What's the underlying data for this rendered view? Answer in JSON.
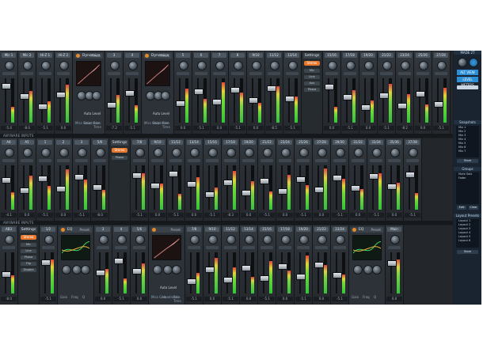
{
  "window": {
    "title": "UA Console"
  },
  "rows": [
    {
      "label": "",
      "strips": [
        {
          "name": "Mic 1",
          "db": "-5.4"
        },
        {
          "name": "Mic 2",
          "db": "-8.0"
        },
        {
          "name": "Hi-Z 1",
          "db": "-5.1"
        },
        {
          "name": "Hi-Z 2",
          "db": "0.0"
        },
        {
          "name": "3",
          "db": "-7.2"
        },
        {
          "name": "4",
          "db": "-5.1"
        },
        {
          "name": "5",
          "db": "0.0"
        },
        {
          "name": "6",
          "db": "-5.1"
        },
        {
          "name": "7",
          "db": "0.0"
        },
        {
          "name": "8",
          "db": "-5.1"
        },
        {
          "name": "9/10",
          "db": "0.0"
        },
        {
          "name": "11/12",
          "db": "-8.5"
        },
        {
          "name": "13/14",
          "db": "-5.1"
        },
        {
          "name": "15/16",
          "db": "0.0"
        },
        {
          "name": "17/18",
          "db": "-5.1"
        },
        {
          "name": "19/20",
          "db": "0.0"
        },
        {
          "name": "21/22",
          "db": "-5.1"
        },
        {
          "name": "23/24",
          "db": "-8.2"
        },
        {
          "name": "25/26",
          "db": "0.0"
        },
        {
          "name": "27/28",
          "db": "-5.1"
        },
        {
          "name": "29/30",
          "db": "0.0"
        }
      ],
      "panels": [
        {
          "title": "Dynamics",
          "preset": "Preset",
          "footer": "Auto Level",
          "labels": [
            "Mics Gain",
            "Headroom",
            "Rise Time"
          ]
        },
        {
          "title": "Dynamics",
          "preset": "Preset",
          "footer": "Auto Level",
          "labels": [
            "Mics Gain",
            "Headroom",
            "Rise Time"
          ]
        }
      ],
      "settings": {
        "title": "Settings",
        "stereo": "Stereo",
        "buttons": [
          "Mic",
          "Line",
          "Aux",
          "Phase"
        ]
      }
    },
    {
      "label": "ANYWARE INPUTS",
      "strips": [
        {
          "name": "A4",
          "db": "-4.1"
        },
        {
          "name": "A5",
          "db": "0.0"
        },
        {
          "name": "1",
          "db": "-5.1"
        },
        {
          "name": "2",
          "db": "0.0"
        },
        {
          "name": "3",
          "db": "-5.1"
        },
        {
          "name": "5/6",
          "db": "-8.0"
        },
        {
          "name": "7/8",
          "db": "-5.1"
        },
        {
          "name": "9/10",
          "db": "0.0"
        },
        {
          "name": "11/12",
          "db": "-5.1"
        },
        {
          "name": "13/14",
          "db": "0.0"
        },
        {
          "name": "15/16",
          "db": "-5.1"
        },
        {
          "name": "17/18",
          "db": "-8.3"
        },
        {
          "name": "19/20",
          "db": "0.0"
        },
        {
          "name": "21/22",
          "db": "-5.1"
        },
        {
          "name": "23/24",
          "db": "0.0"
        },
        {
          "name": "25/26",
          "db": "-5.1"
        },
        {
          "name": "27/28",
          "db": "0.0"
        },
        {
          "name": "29/30",
          "db": "-5.1"
        },
        {
          "name": "31/32",
          "db": "0.0"
        },
        {
          "name": "33/34",
          "db": "-5.1"
        },
        {
          "name": "35/36",
          "db": "0.0"
        },
        {
          "name": "37/38",
          "db": "-5.1"
        }
      ],
      "settings": {
        "title": "Settings",
        "stereo": "Stereo",
        "buttons": [
          "Phase"
        ]
      }
    },
    {
      "label": "ANYWARE INPUTS",
      "strips": [
        {
          "name": "AB3",
          "db": "-8.0"
        },
        {
          "name": "1/2",
          "db": "-5.1"
        },
        {
          "name": "3",
          "db": "0.0"
        },
        {
          "name": "4",
          "db": "-5.1"
        },
        {
          "name": "5/6",
          "db": "0.0"
        },
        {
          "name": "7/8",
          "db": "-5.1"
        },
        {
          "name": "9/10",
          "db": "0.0"
        },
        {
          "name": "11/12",
          "db": "-5.1"
        },
        {
          "name": "13/14",
          "db": "0.0"
        },
        {
          "name": "15/16",
          "db": "-5.1"
        },
        {
          "name": "17/18",
          "db": "0.0"
        },
        {
          "name": "19/20",
          "db": "-5.1"
        },
        {
          "name": "21/22",
          "db": "0.0"
        },
        {
          "name": "23/24",
          "db": "-5.1"
        },
        {
          "name": "Main",
          "db": "0.0"
        }
      ],
      "panels": [
        {
          "title": "EQ",
          "preset": "Preset",
          "footer": "",
          "labels": [
            "Gain",
            "Freq",
            "Q"
          ]
        },
        {
          "title": "",
          "preset": "Preset",
          "footer": "Auto Level",
          "labels": [
            "Mics Gain",
            "Headroom",
            "Rise Time"
          ]
        },
        {
          "title": "EQ",
          "preset": "Preset",
          "footer": "",
          "labels": [
            "Gain",
            "Freq",
            "Q"
          ]
        }
      ],
      "settings": {
        "title": "Settings",
        "stereo": "Stereo",
        "buttons": [
          "Mic",
          "Line",
          "Phase",
          "Flip",
          "Disable"
        ]
      }
    }
  ],
  "right_panel": {
    "title": "MADE 2T",
    "blue_buttons": [
      "ALT VIEW",
      "LEVEL METERS"
    ],
    "snapshots_title": "Snapshots",
    "snapshots": [
      "Mix 1",
      "Mix 2",
      "Mix 3",
      "Mix 4",
      "Mix 5",
      "Mix 6",
      "Mix 7"
    ],
    "store_label": "Store",
    "groups_title": "Groups",
    "groups_header": "Mute Solo Fader",
    "groups_buttons": [
      "Edit",
      "Clear"
    ],
    "layout_title": "Layout Presets",
    "layouts": [
      "Layout 1",
      "Layout 2",
      "Layout 3",
      "Layout 4",
      "Layout 5",
      "Layout 6"
    ],
    "layout_store": "Store"
  }
}
